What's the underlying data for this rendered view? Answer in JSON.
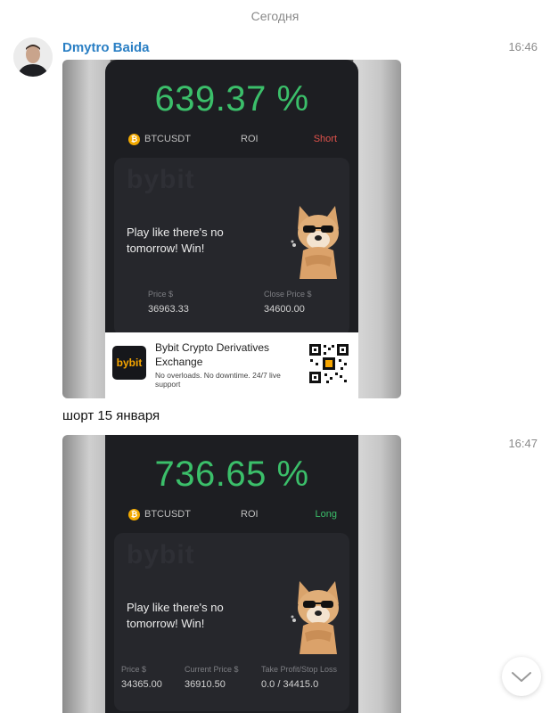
{
  "date_separator": "Сегодня",
  "sender": {
    "name": "Dmytro Baida"
  },
  "messages": [
    {
      "time": "16:46",
      "caption": "шорт 15 января",
      "screenshot": {
        "roi_percent": "639.37 %",
        "pair": "BTCUSDT",
        "roi_label": "ROI",
        "side": "Short",
        "watermark": "bybit",
        "slogan_line1": "Play like there's no",
        "slogan_line2": "tomorrow! Win!",
        "fields": [
          {
            "label": "Price $",
            "value": "36963.33"
          },
          {
            "label": "Close Price $",
            "value": "34600.00"
          }
        ],
        "ad": {
          "logo_text": "bybit",
          "title": "Bybit Crypto Derivatives Exchange",
          "description": "No overloads. No downtime. 24/7 live support"
        }
      }
    },
    {
      "time": "16:47",
      "screenshot": {
        "roi_percent": "736.65 %",
        "pair": "BTCUSDT",
        "roi_label": "ROI",
        "side": "Long",
        "watermark": "bybit",
        "slogan_line1": "Play like there's no",
        "slogan_line2": "tomorrow! Win!",
        "fields": [
          {
            "label": "Price $",
            "value": "34365.00"
          },
          {
            "label": "Current Price $",
            "value": "36910.50"
          },
          {
            "label": "Take Profit/Stop Loss",
            "value": "0.0 / 34415.0"
          }
        ]
      }
    }
  ],
  "colors": {
    "sender": "#2a7fc4",
    "profit_green": "#3bbf6a",
    "short_red": "#e0524b",
    "bybit_orange": "#f7a600"
  },
  "icons": {
    "coin": "bitcoin-coin-icon",
    "scroll": "chevron-down-icon"
  }
}
